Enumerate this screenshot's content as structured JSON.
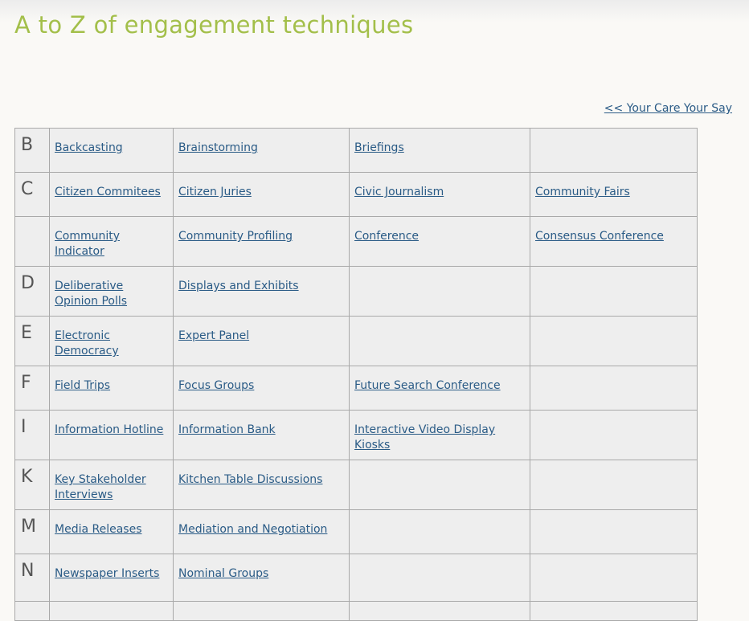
{
  "page": {
    "title": "A to Z of engagement techniques",
    "back_link": "<< Your Care Your Say"
  },
  "rows": [
    {
      "letter": "B",
      "items": [
        "Backcasting",
        "Brainstorming",
        "Briefings",
        ""
      ]
    },
    {
      "letter": "C",
      "items": [
        "Citizen Commitees",
        "Citizen Juries",
        "Civic Journalism",
        "Community Fairs"
      ]
    },
    {
      "letter": "",
      "items": [
        "Community Indicator",
        "Community Profiling",
        "Conference",
        "Consensus Conference"
      ]
    },
    {
      "letter": "D",
      "items": [
        "Deliberative Opinion Polls",
        "Displays and Exhibits",
        "",
        ""
      ]
    },
    {
      "letter": "E",
      "items": [
        "Electronic Democracy",
        "Expert Panel",
        "",
        ""
      ]
    },
    {
      "letter": "F",
      "items": [
        "Field Trips",
        "Focus Groups",
        "Future Search Conference",
        ""
      ]
    },
    {
      "letter": "I",
      "items": [
        "Information Hotline",
        "Information Bank",
        "Interactive Video Display Kiosks",
        ""
      ]
    },
    {
      "letter": "K",
      "items": [
        "Key Stakeholder Interviews",
        "Kitchen Table Discussions",
        "",
        ""
      ]
    },
    {
      "letter": "M",
      "items": [
        "Media Releases",
        "Mediation and Negotiation",
        "",
        ""
      ]
    },
    {
      "letter": "N",
      "items": [
        "Newspaper Inserts",
        "Nominal Groups",
        "",
        ""
      ]
    },
    {
      "letter": "",
      "items": [
        "",
        "",
        "",
        ""
      ]
    }
  ]
}
